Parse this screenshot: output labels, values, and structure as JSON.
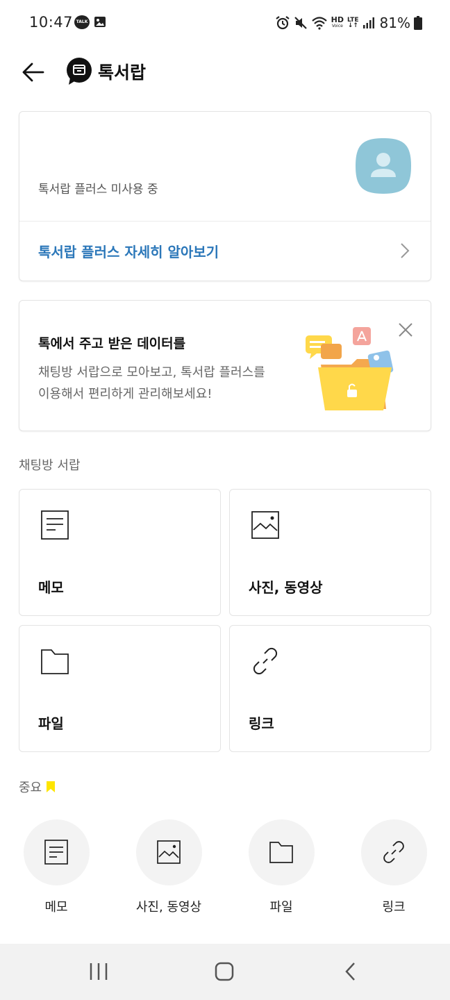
{
  "status_bar": {
    "time": "10:47",
    "talk_badge": "TALK",
    "hd_label": "HD",
    "voice_label": "Voice",
    "lte_label": "LTE",
    "battery": "81%"
  },
  "header": {
    "title": "톡서랍"
  },
  "plus_card": {
    "status": "톡서랍 플러스 미사용 중",
    "link": "톡서랍 플러스 자세히 알아보기",
    "avatar_color": "#8fc6d8"
  },
  "promo": {
    "title": "톡에서 주고 받은 데이터를",
    "line1": "채팅방 서랍으로 모아보고, 톡서랍 플러스를",
    "line2": "이용해서 편리하게 관리해보세요!"
  },
  "chat_drawer": {
    "label": "채팅방 서랍",
    "tiles": [
      {
        "label": "메모",
        "icon": "memo-icon"
      },
      {
        "label": "사진, 동영상",
        "icon": "photo-icon"
      },
      {
        "label": "파일",
        "icon": "folder-icon"
      },
      {
        "label": "링크",
        "icon": "link-icon"
      }
    ]
  },
  "important": {
    "label": "중요",
    "bookmark_color": "#fee500",
    "items": [
      {
        "label": "메모",
        "icon": "memo-icon"
      },
      {
        "label": "사진, 동영상",
        "icon": "photo-icon"
      },
      {
        "label": "파일",
        "icon": "folder-icon"
      },
      {
        "label": "링크",
        "icon": "link-icon"
      }
    ]
  },
  "colors": {
    "link_blue": "#2b77b9",
    "card_border": "#e3e3e3"
  }
}
